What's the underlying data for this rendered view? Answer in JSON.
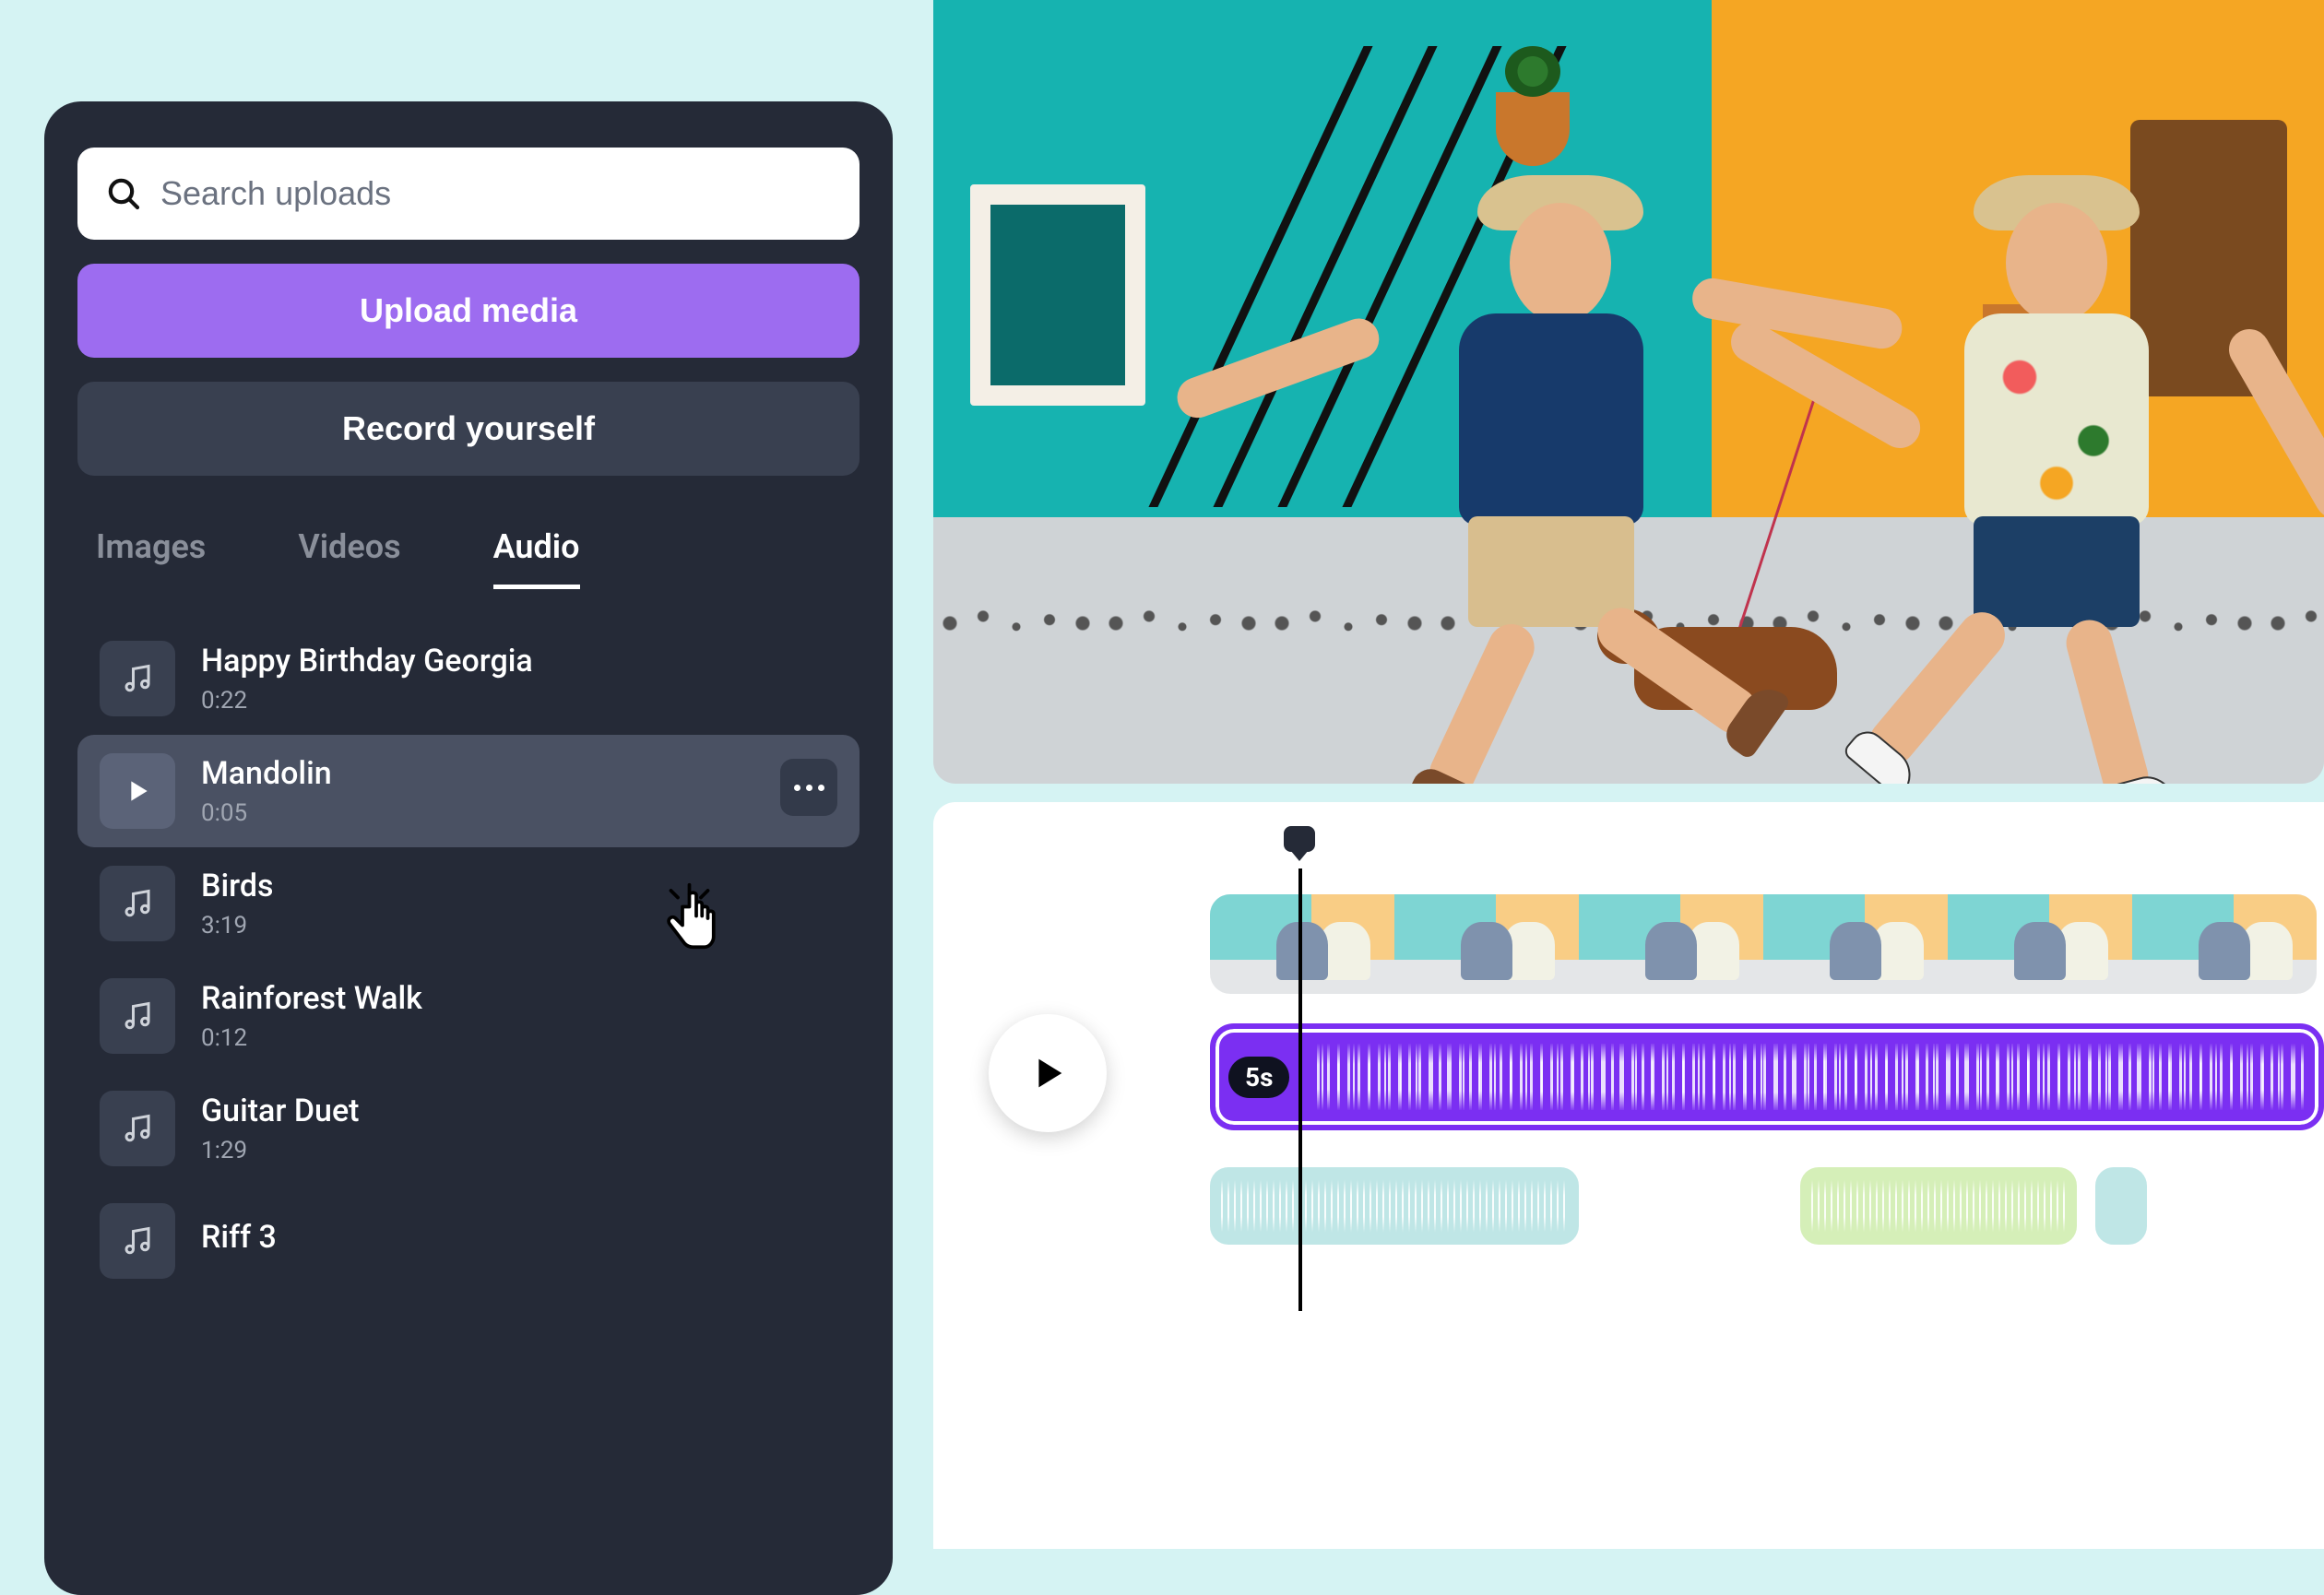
{
  "search": {
    "placeholder": "Search uploads"
  },
  "buttons": {
    "upload": "Upload media",
    "record": "Record yourself"
  },
  "tabs": [
    {
      "label": "Images",
      "active": false
    },
    {
      "label": "Videos",
      "active": false
    },
    {
      "label": "Audio",
      "active": true
    }
  ],
  "audio_items": [
    {
      "title": "Happy Birthday Georgia",
      "duration": "0:22",
      "selected": false
    },
    {
      "title": "Mandolin",
      "duration": "0:05",
      "selected": true
    },
    {
      "title": "Birds",
      "duration": "3:19",
      "selected": false
    },
    {
      "title": "Rainforest Walk",
      "duration": "0:12",
      "selected": false
    },
    {
      "title": "Guitar Duet",
      "duration": "1:29",
      "selected": false
    },
    {
      "title": "Riff 3",
      "duration": "",
      "selected": false
    }
  ],
  "timeline": {
    "audio_chip": "5s"
  },
  "colors": {
    "accent_purple": "#7b2ff2",
    "upload_purple": "#9d6cf0",
    "panel": "#252a37"
  }
}
